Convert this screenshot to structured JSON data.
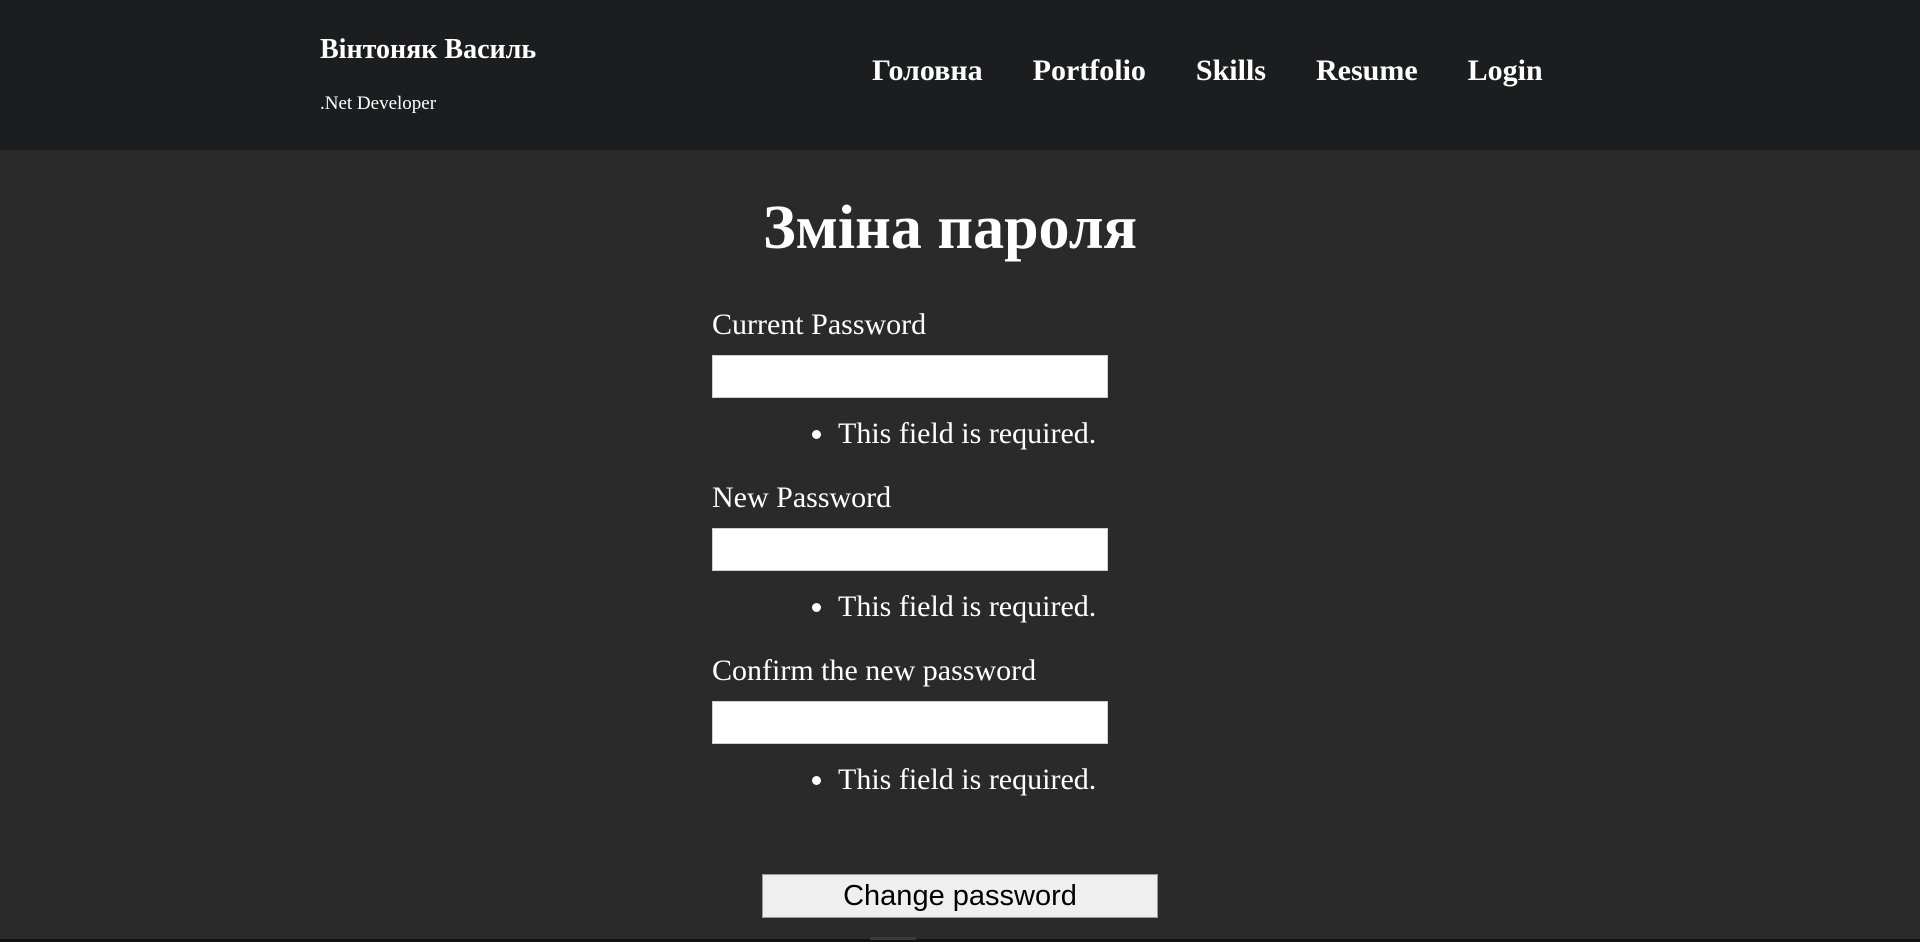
{
  "header": {
    "brand_name": "Вінтоняк Василь",
    "brand_subtitle": ".Net Developer",
    "nav": [
      {
        "label": "Головна"
      },
      {
        "label": "Portfolio"
      },
      {
        "label": "Skills"
      },
      {
        "label": "Resume"
      },
      {
        "label": "Login"
      }
    ]
  },
  "main": {
    "title": "Зміна пароля",
    "fields": [
      {
        "label": "Current Password",
        "value": "",
        "error": "This field is required."
      },
      {
        "label": "New Password",
        "value": "",
        "error": "This field is required."
      },
      {
        "label": "Confirm the new password",
        "value": "",
        "error": "This field is required."
      }
    ],
    "submit_label": "Change password"
  },
  "colors": {
    "header_bg": "#1c1d1f",
    "page_bg": "#2a2a2a",
    "text": "#ffffff",
    "button_bg": "#efefef"
  }
}
